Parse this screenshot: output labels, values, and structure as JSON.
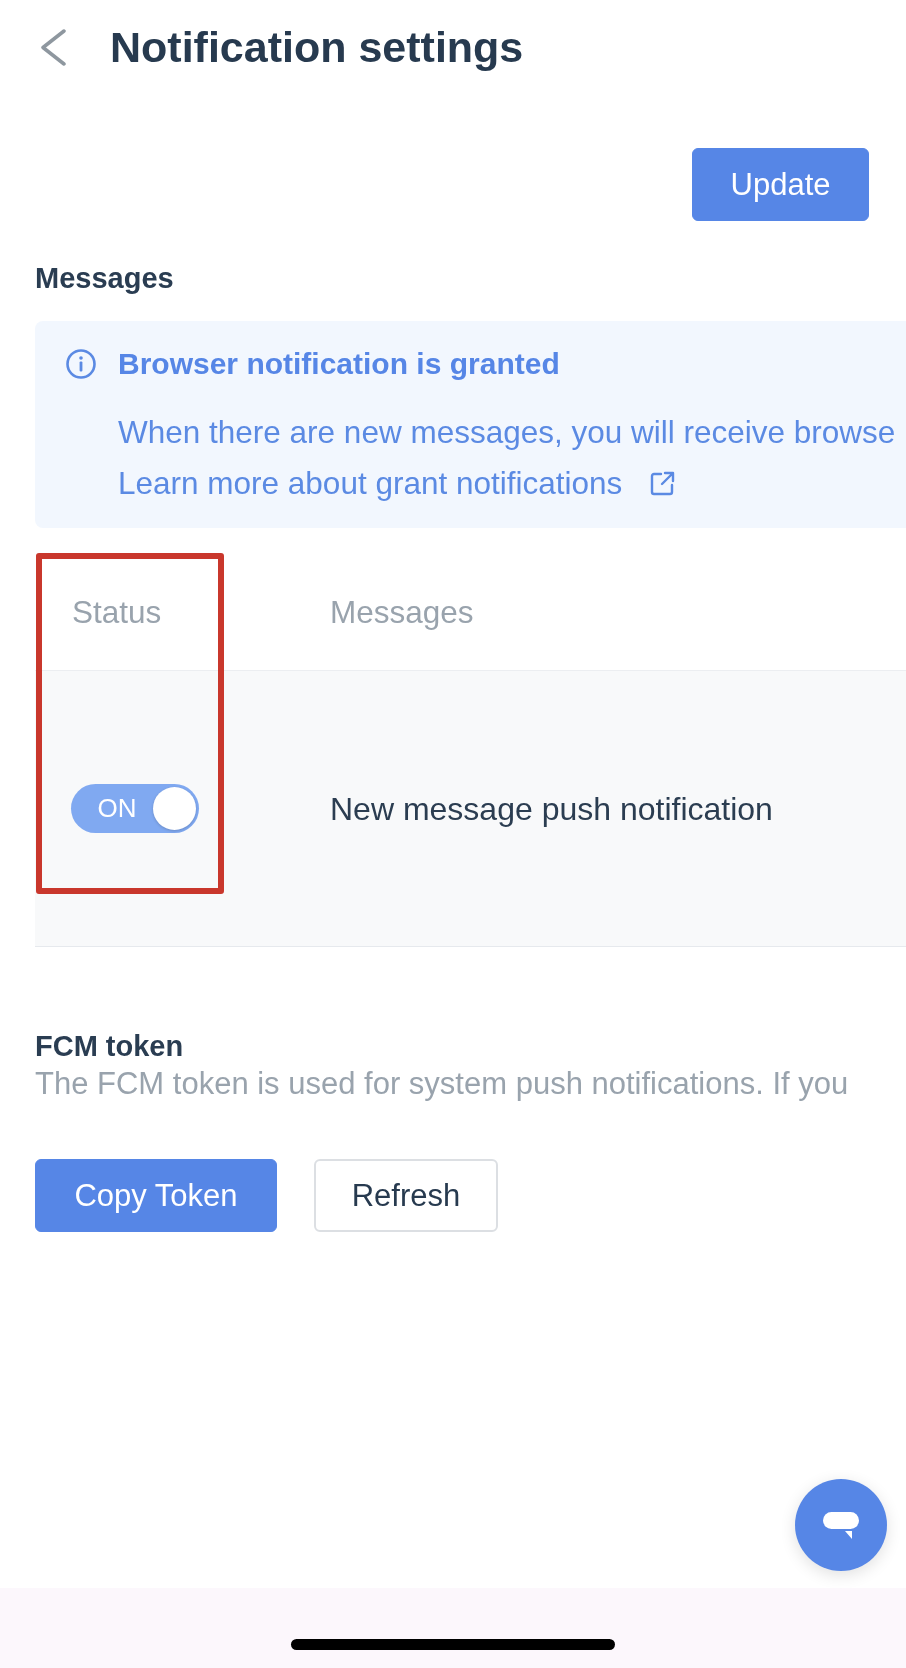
{
  "header": {
    "title": "Notification settings"
  },
  "toolbar": {
    "update_button": "Update"
  },
  "messages_section": {
    "title": "Messages",
    "notice": {
      "title": "Browser notification is granted",
      "text": "When there are new messages, you will receive browse",
      "link": "Learn more about grant notifications"
    },
    "table": {
      "columns": [
        {
          "label": "Status",
          "highlighted": true
        },
        {
          "label": "Messages",
          "highlighted": false
        }
      ],
      "rows": [
        {
          "status": {
            "label": "ON",
            "on": true
          },
          "message": "New message push notification"
        }
      ]
    }
  },
  "fcm_section": {
    "title": "FCM token",
    "description": "The FCM token is used for system push notifications. If you",
    "buttons": [
      {
        "label": "Copy Token",
        "kind": "primary"
      },
      {
        "label": "Refresh",
        "kind": "default"
      }
    ]
  }
}
